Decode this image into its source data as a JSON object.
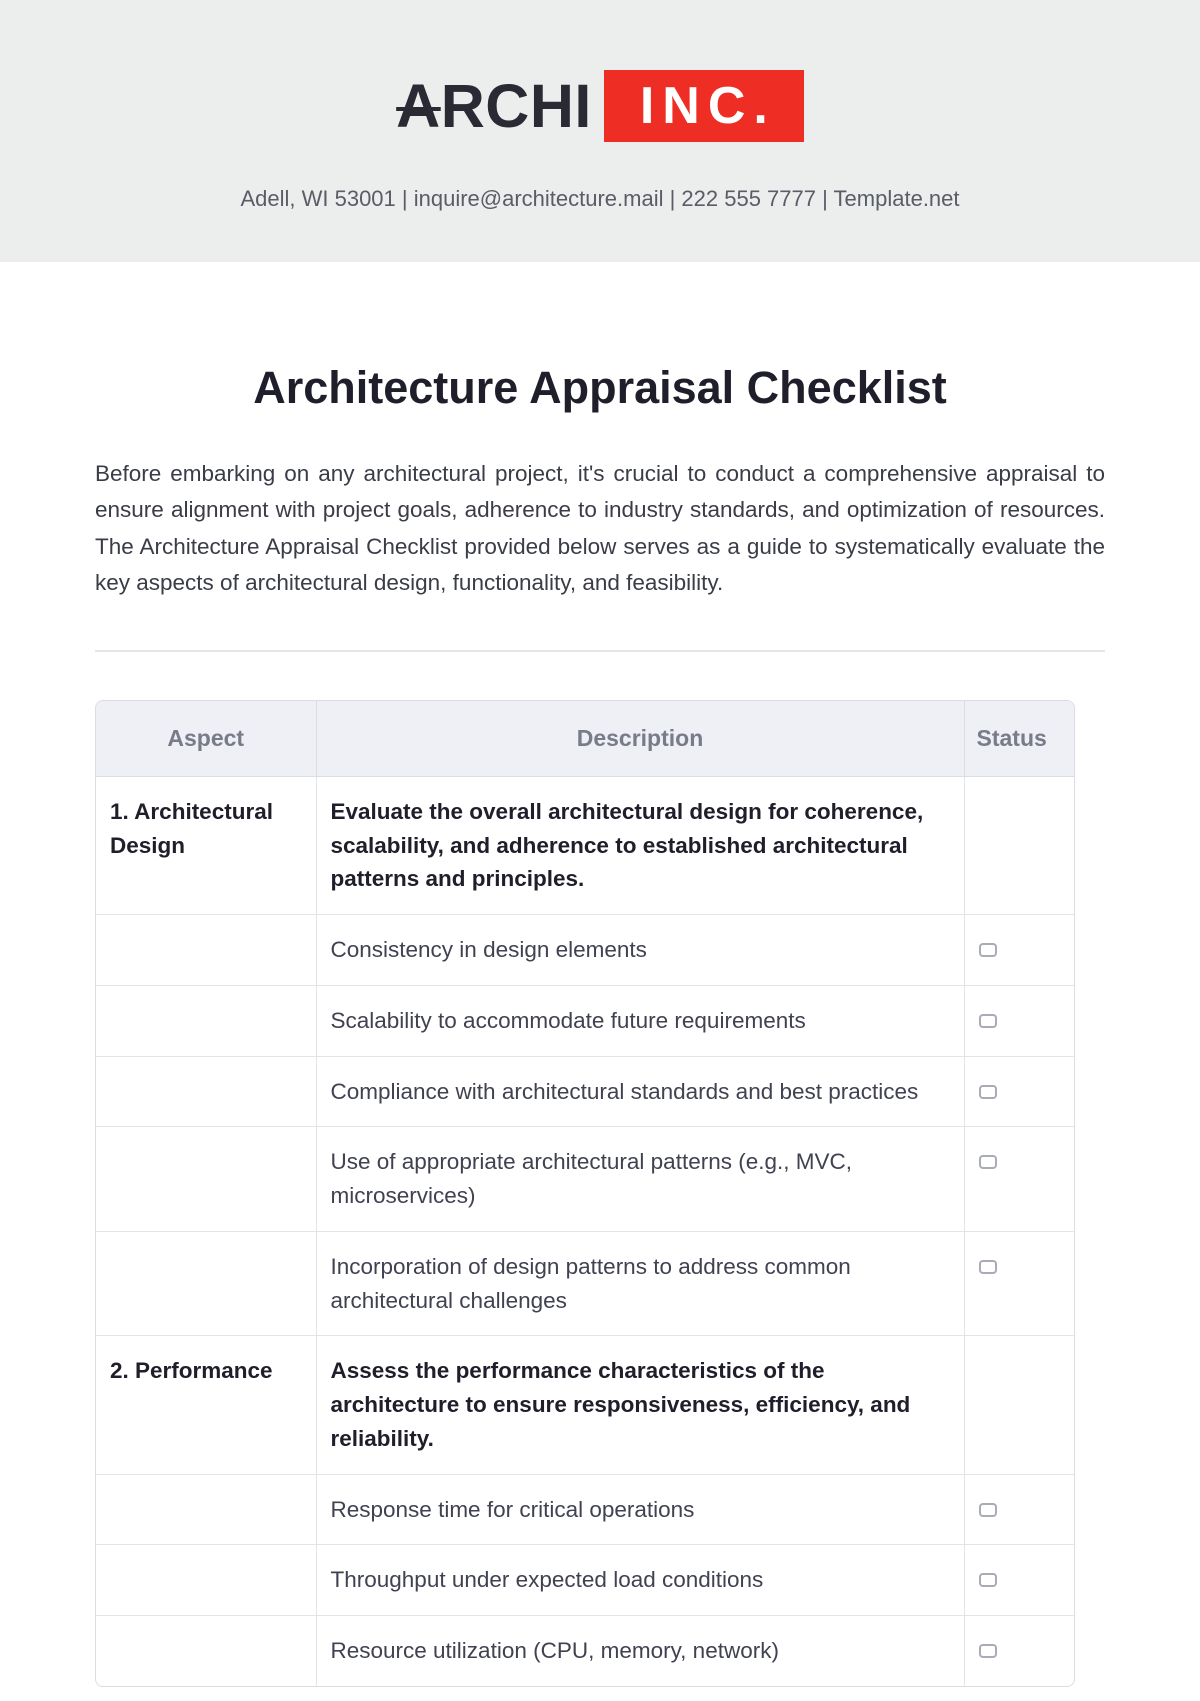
{
  "header": {
    "logo_word1_part1": "A",
    "logo_word1_part2": "RCHI",
    "logo_word2": "INC.",
    "contact": "Adell, WI 53001 | inquire@architecture.mail | 222 555 7777 | Template.net"
  },
  "title": "Architecture Appraisal Checklist",
  "intro": "Before embarking on any architectural project, it's crucial to conduct a comprehensive appraisal to ensure alignment with project goals, adherence to industry standards, and optimization of resources. The Architecture Appraisal Checklist provided below serves as a guide to systematically evaluate the key aspects of architectural design, functionality, and feasibility.",
  "columns": {
    "aspect": "Aspect",
    "description": "Description",
    "status": "Status"
  },
  "sections": [
    {
      "aspect": "1. Architectural Design",
      "summary": "Evaluate the overall architectural design for coherence, scalability, and adherence to established architectural patterns and principles.",
      "items": [
        "Consistency in design elements",
        "Scalability to accommodate future requirements",
        "Compliance with architectural standards and best practices",
        "Use of appropriate architectural patterns (e.g., MVC, microservices)",
        "Incorporation of design patterns to address common architectural challenges"
      ]
    },
    {
      "aspect": "2. Performance",
      "summary": "Assess the performance characteristics of the architecture to ensure responsiveness, efficiency, and reliability.",
      "items": [
        "Response time for critical operations",
        "Throughput under expected load conditions",
        "Resource utilization (CPU, memory, network)"
      ]
    }
  ]
}
